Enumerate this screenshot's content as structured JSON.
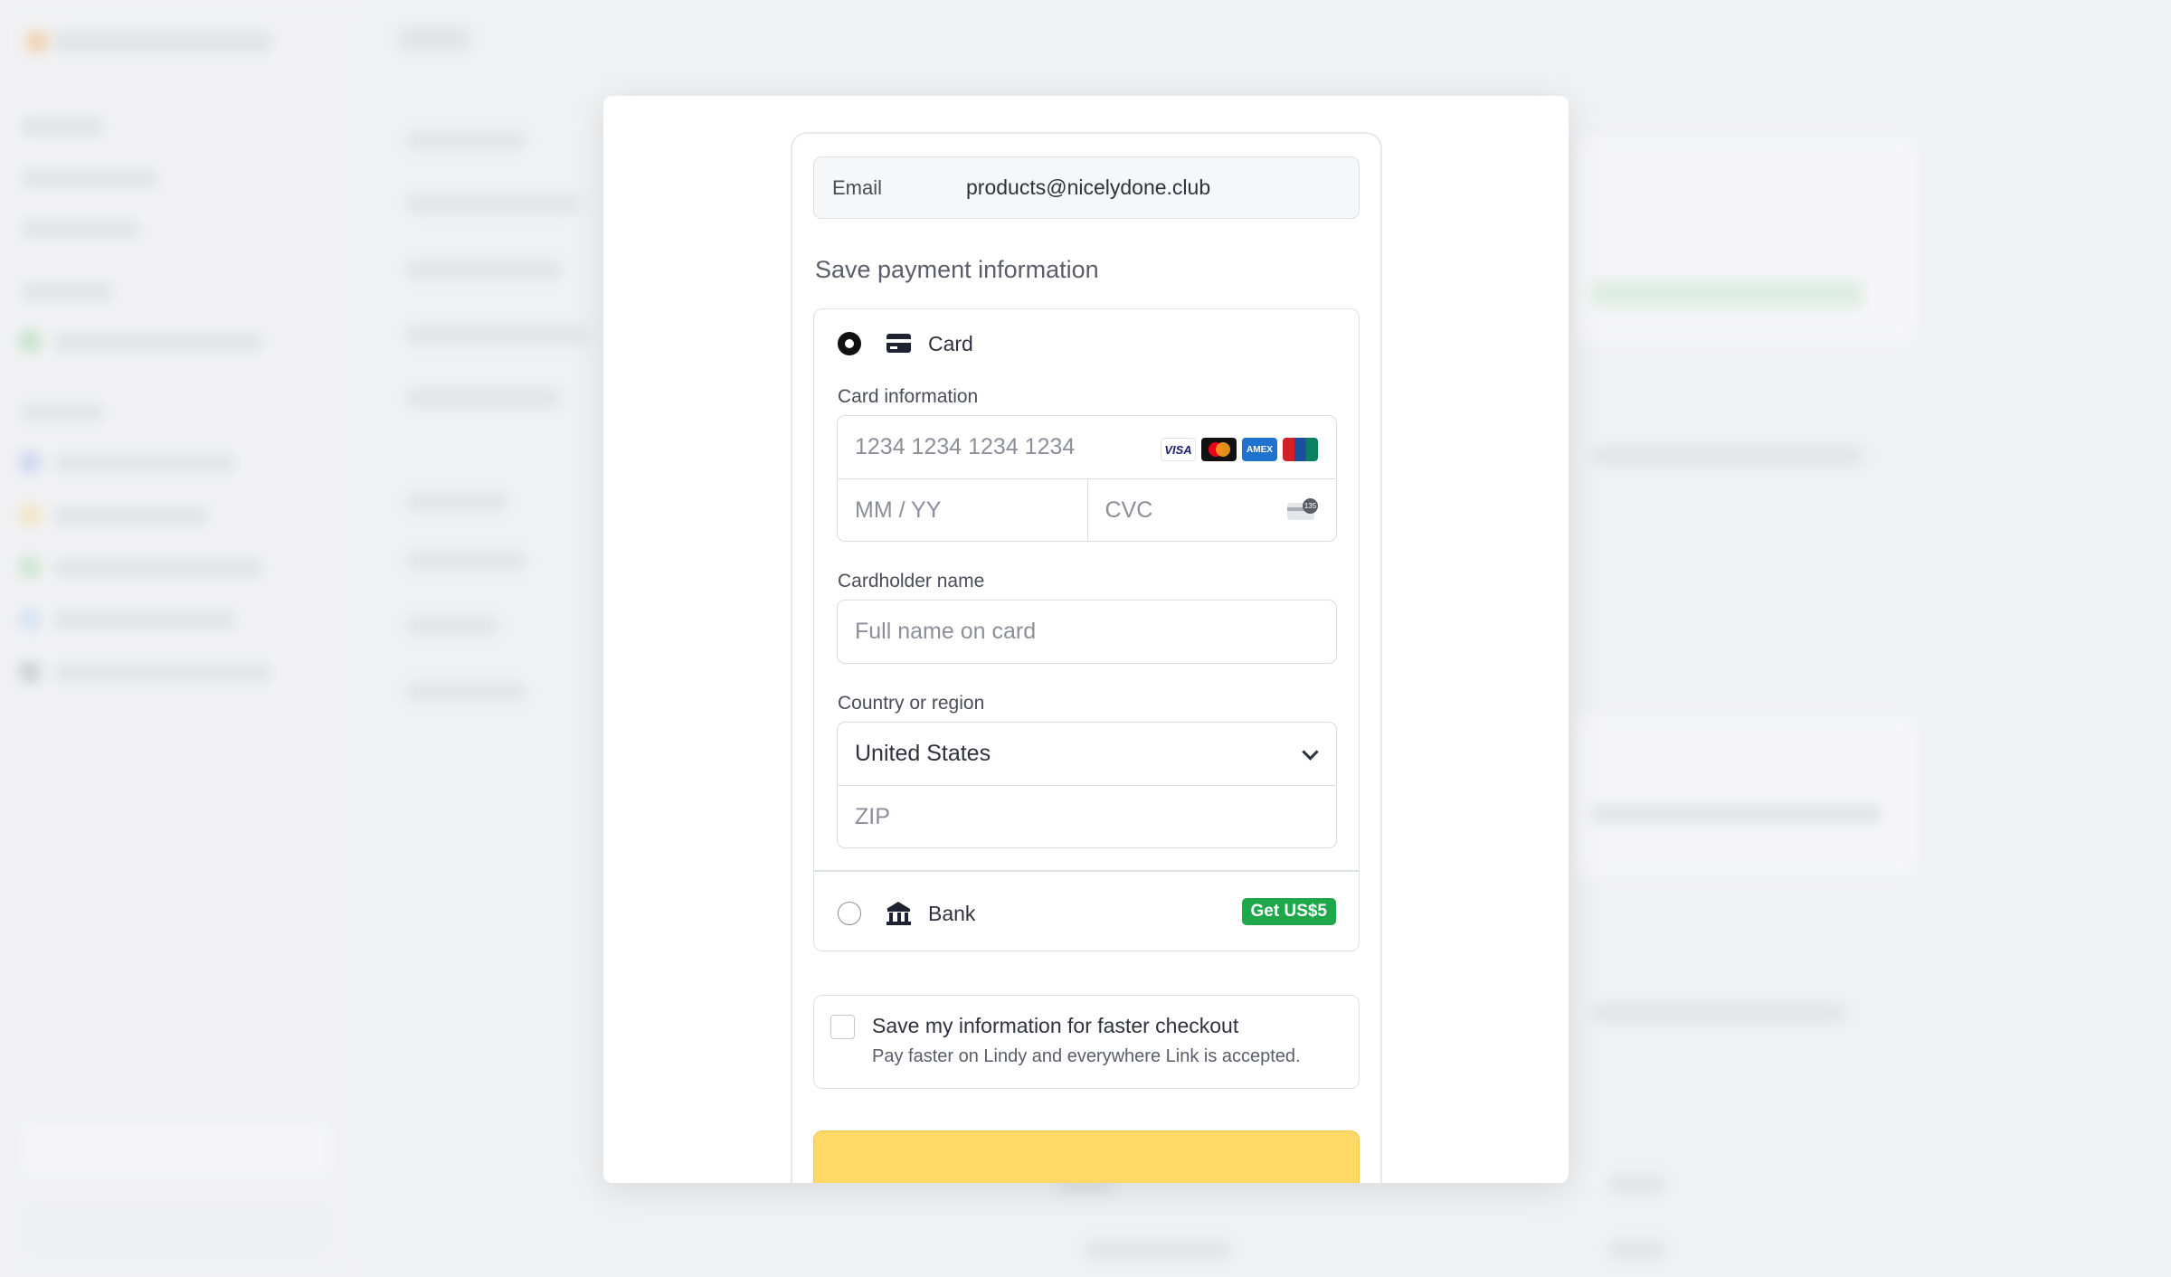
{
  "checkout": {
    "email_label": "Email",
    "email_value": "products@nicelydone.club",
    "section_title": "Save payment information",
    "methods": {
      "card_label": "Card",
      "bank_label": "Bank",
      "bank_promo": "Get US$5"
    },
    "card_information_label": "Card information",
    "card_number_placeholder": "1234 1234 1234 1234",
    "expiry_placeholder": "MM / YY",
    "cvc_placeholder": "CVC",
    "cardholder_label": "Cardholder name",
    "cardholder_placeholder": "Full name on card",
    "country_label": "Country or region",
    "country_value": "United States",
    "zip_placeholder": "ZIP",
    "save_info_title": "Save my information for faster checkout",
    "save_info_subtitle": "Pay faster on Lindy and everywhere Link is accepted.",
    "brands": [
      "VISA",
      "mastercard",
      "AMEX",
      "UnionPay"
    ],
    "cvc_badge": "135"
  },
  "colors": {
    "accent_button": "#ffd866",
    "promo_green": "#1ea84a"
  },
  "icons": [
    "card-icon",
    "bank-icon",
    "chevron-down-icon",
    "cvc-icon"
  ]
}
